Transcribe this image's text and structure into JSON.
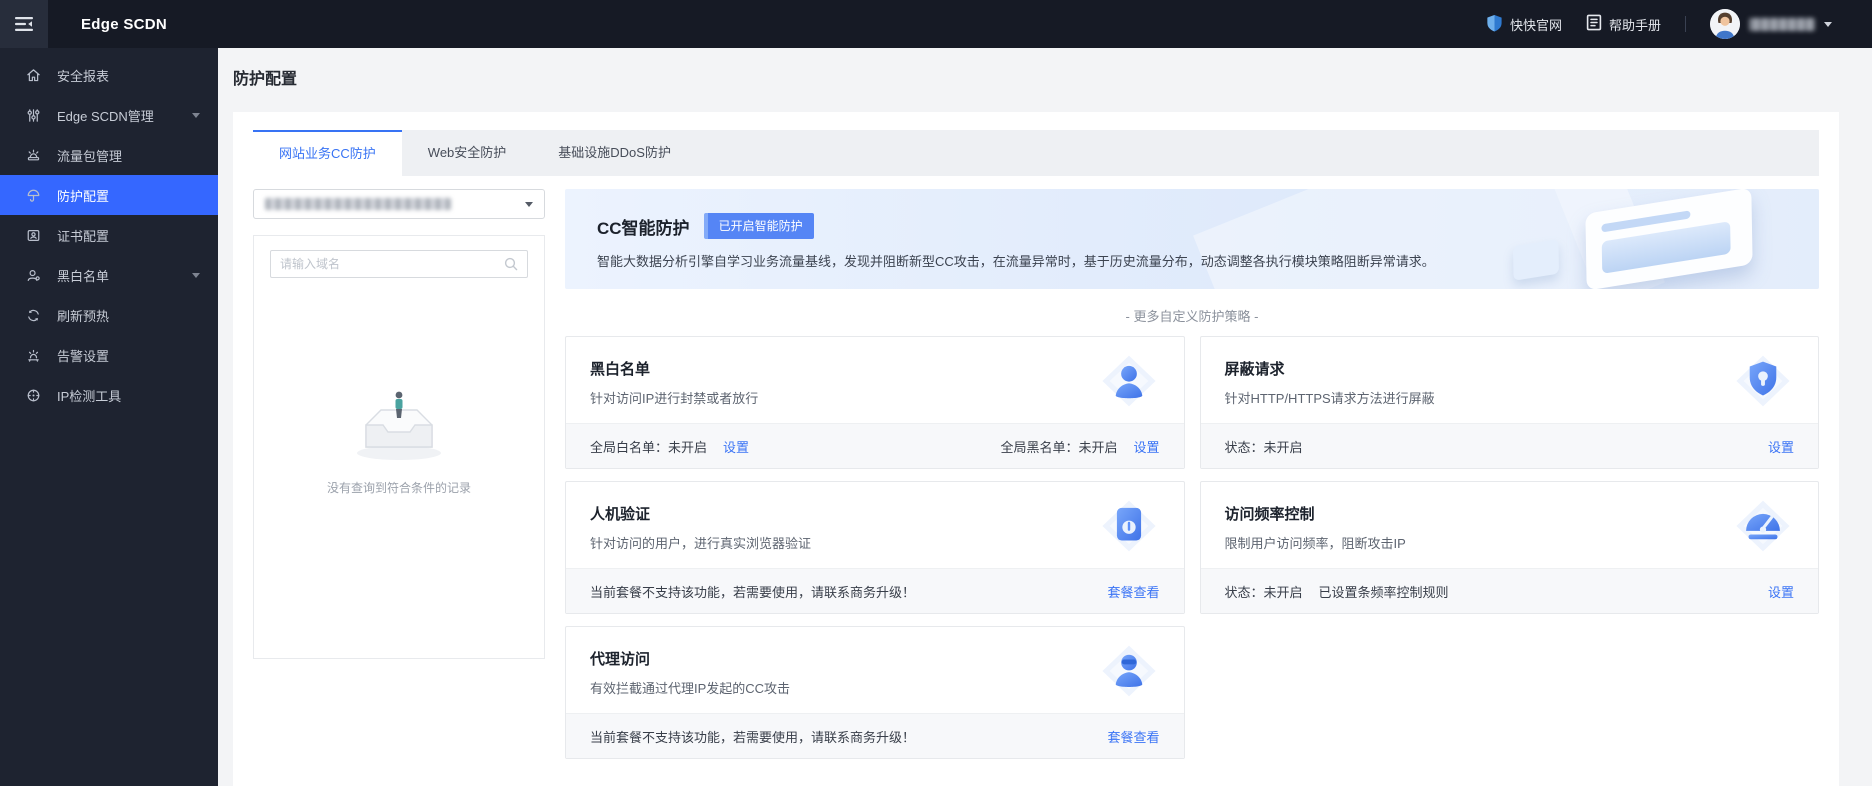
{
  "topbar": {
    "app_title": "Edge SCDN",
    "links": [
      {
        "icon": "shield-icon",
        "label": "快快官网"
      },
      {
        "icon": "manual-icon",
        "label": "帮助手册"
      }
    ],
    "user_name_masked": true
  },
  "sidebar": {
    "items": [
      {
        "label": "安全报表",
        "icon": "home",
        "active": false,
        "expandable": false
      },
      {
        "label": "Edge SCDN管理",
        "icon": "sliders",
        "active": false,
        "expandable": true
      },
      {
        "label": "流量包管理",
        "icon": "traffic",
        "active": false,
        "expandable": false
      },
      {
        "label": "防护配置",
        "icon": "umbrella",
        "active": true,
        "expandable": false
      },
      {
        "label": "证书配置",
        "icon": "certificate",
        "active": false,
        "expandable": false
      },
      {
        "label": "黑白名单",
        "icon": "user",
        "active": false,
        "expandable": true
      },
      {
        "label": "刷新预热",
        "icon": "refresh",
        "active": false,
        "expandable": false
      },
      {
        "label": "告警设置",
        "icon": "alarm",
        "active": false,
        "expandable": false
      },
      {
        "label": "IP检测工具",
        "icon": "ip-detect",
        "active": false,
        "expandable": false
      }
    ]
  },
  "page": {
    "title": "防护配置"
  },
  "tabs": [
    {
      "label": "网站业务CC防护",
      "active": true
    },
    {
      "label": "Web安全防护",
      "active": false
    },
    {
      "label": "基础设施DDoS防护",
      "active": false
    }
  ],
  "domain_panel": {
    "dropdown_value_masked": true,
    "search_placeholder": "请输入域名",
    "empty_text": "没有查询到符合条件的记录"
  },
  "smart_protect": {
    "title": "CC智能防护",
    "badge": "已开启智能防护",
    "desc": "智能大数据分析引擎自学习业务流量基线，发现并阻断新型CC攻击，在流量异常时，基于历史流量分布，动态调整各执行模块策略阻断异常请求。"
  },
  "more_title": "- 更多自定义防护策略 -",
  "cards": [
    {
      "title": "黑白名单",
      "desc": "针对访问IP进行封禁或者放行",
      "icon": "person",
      "footer_left": [
        {
          "text": "全局白名单：未开启",
          "link": false
        },
        {
          "text": "设置",
          "link": true
        }
      ],
      "footer_right": [
        {
          "text": "全局黑名单：未开启",
          "link": false
        },
        {
          "text": "设置",
          "link": true
        }
      ]
    },
    {
      "title": "屏蔽请求",
      "desc": "针对HTTP/HTTPS请求方法进行屏蔽",
      "icon": "shield",
      "footer_left": [
        {
          "text": "状态：未开启",
          "link": false
        }
      ],
      "footer_right": [
        {
          "text": "设置",
          "link": true
        }
      ]
    },
    {
      "title": "人机验证",
      "desc": "针对访问的用户，进行真实浏览器验证",
      "icon": "verify",
      "footer_left": [
        {
          "text": "当前套餐不支持该功能，若需要使用，请联系商务升级！",
          "link": false
        }
      ],
      "footer_right": [
        {
          "text": "套餐查看",
          "link": true
        }
      ]
    },
    {
      "title": "访问频率控制",
      "desc": "限制用户访问频率，阻断攻击IP",
      "icon": "gauge",
      "footer_left": [
        {
          "text": "状态：未开启",
          "link": false
        },
        {
          "text": "已设置条频率控制规则",
          "link": false
        }
      ],
      "footer_right": [
        {
          "text": "设置",
          "link": true
        }
      ]
    },
    {
      "title": "代理访问",
      "desc": "有效拦截通过代理IP发起的CC攻击",
      "icon": "proxy-person",
      "footer_left": [
        {
          "text": "当前套餐不支持该功能，若需要使用，请联系商务升级！",
          "link": false
        }
      ],
      "footer_right": [
        {
          "text": "套餐查看",
          "link": true
        }
      ]
    }
  ],
  "colors": {
    "sidebar_active": "#3567ff",
    "tab_active": "#3873f4",
    "link_blue": "#3b74f5",
    "badge_blue": "#5585f5",
    "topbar_bg": "#161a25",
    "sidebar_bg": "#1e2330"
  }
}
